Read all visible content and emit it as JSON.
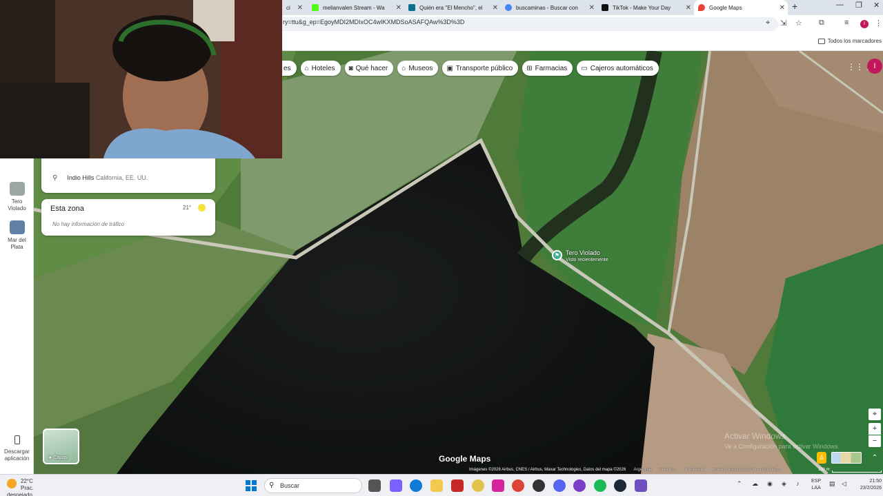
{
  "browser": {
    "tabs": [
      {
        "label": "ci",
        "favicon_color": "#2e7d32"
      },
      {
        "label": "melianvalen Stream - Wa",
        "favicon_color": "#53fc18"
      },
      {
        "label": "Quién era \"El Mencho\", el",
        "favicon_color": "#0b6e8a"
      },
      {
        "label": "buscaminas - Buscar con",
        "favicon_color": "#4285f4"
      },
      {
        "label": "TikTok - Make Your Day",
        "favicon_color": "#111111"
      },
      {
        "label": "Google Maps",
        "favicon_color": "#ea4335"
      }
    ],
    "url": "ry=ttu&g_ep=EgoyMDI2MDIxOC4wIKXMDSoASAFQAw%3D%3D",
    "bookmarks_all": "Todos los marcadores",
    "profile_initial": "I"
  },
  "maps": {
    "chips": [
      {
        "label": "es",
        "icon": "none"
      },
      {
        "label": "Hoteles",
        "icon": "bed-icon"
      },
      {
        "label": "Qué hacer",
        "icon": "camera-icon"
      },
      {
        "label": "Museos",
        "icon": "museum-icon"
      },
      {
        "label": "Transporte público",
        "icon": "bus-icon"
      },
      {
        "label": "Farmacias",
        "icon": "pharmacy-icon"
      },
      {
        "label": "Cajeros automáticos",
        "icon": "atm-icon"
      }
    ],
    "rail": [
      {
        "label1": "Tero",
        "label2": "Violado"
      },
      {
        "label1": "Mar del",
        "label2": "Plata"
      },
      {
        "label1": "Descargar",
        "label2": "aplicación"
      }
    ],
    "recent": {
      "place": "Indio Hills",
      "region": "California, EE. UU."
    },
    "zone": {
      "title": "Esta zona",
      "temp": "21°",
      "note": "No hay información de tráfico"
    },
    "place": {
      "name": "Tero Violado",
      "sub": "Visto recientemente"
    },
    "layers_label": "Capas",
    "logo": "Google Maps",
    "attribution": "Imágenes ©2026 Airbus, CNES / Airbus, Maxar Technologies, Datos del mapa ©2026",
    "footer_links": [
      "Argentina",
      "Términos",
      "Privacidad",
      "Enviar comentarios sobre el producto"
    ],
    "scale": "100 m",
    "activate_title": "Activar Windows",
    "activate_sub": "Ve a Configuración para activar Windows."
  },
  "taskbar": {
    "weather_temp": "22°C",
    "weather_desc": "Prac. despejado",
    "search_placeholder": "Buscar",
    "lang1": "ESP",
    "lang2": "LAA",
    "time": "21:50",
    "date": "23/2/2026"
  }
}
